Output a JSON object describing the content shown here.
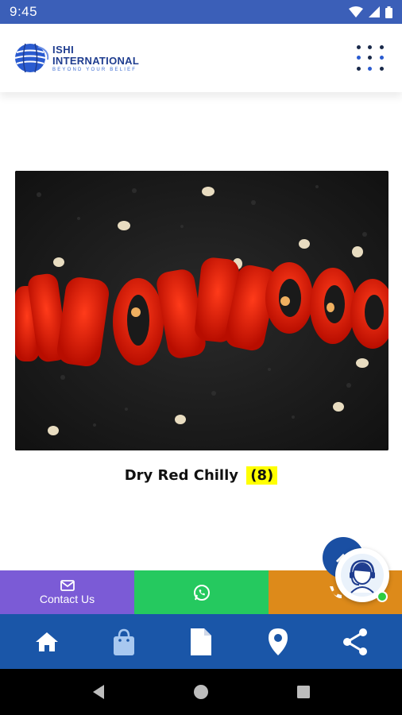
{
  "status_bar": {
    "time": "9:45",
    "icons": [
      "wifi-icon",
      "signal-icon",
      "battery-icon"
    ]
  },
  "header": {
    "logo": {
      "name_line1": "ISHI",
      "name_line2": "INTERNATIONAL",
      "tagline": "Beyond Your Belief"
    },
    "menu_icon": "grid-menu-icon"
  },
  "product": {
    "name": "Dry Red Chilly",
    "count": "(8)",
    "image_description": "red-chilly-slices-image"
  },
  "contact_strip": {
    "contact_label": "Contact Us",
    "contact_icon": "mail-icon",
    "whatsapp_icon": "whatsapp-icon",
    "call_icon": "phone-icon",
    "colors": {
      "contact": "#7b5bd6",
      "whatsapp": "#25c95f",
      "call": "#dd8a1a"
    }
  },
  "bottom_nav": {
    "items": [
      "home-icon",
      "shopping-bag-icon",
      "document-icon",
      "location-icon",
      "share-icon"
    ],
    "color": "#1a56a8"
  },
  "system_nav": [
    "back-icon",
    "home-circle-icon",
    "recents-icon"
  ],
  "colors": {
    "status_bar": "#3b5fb8",
    "brand": "#1f3d8f",
    "highlight": "#ffff00"
  }
}
